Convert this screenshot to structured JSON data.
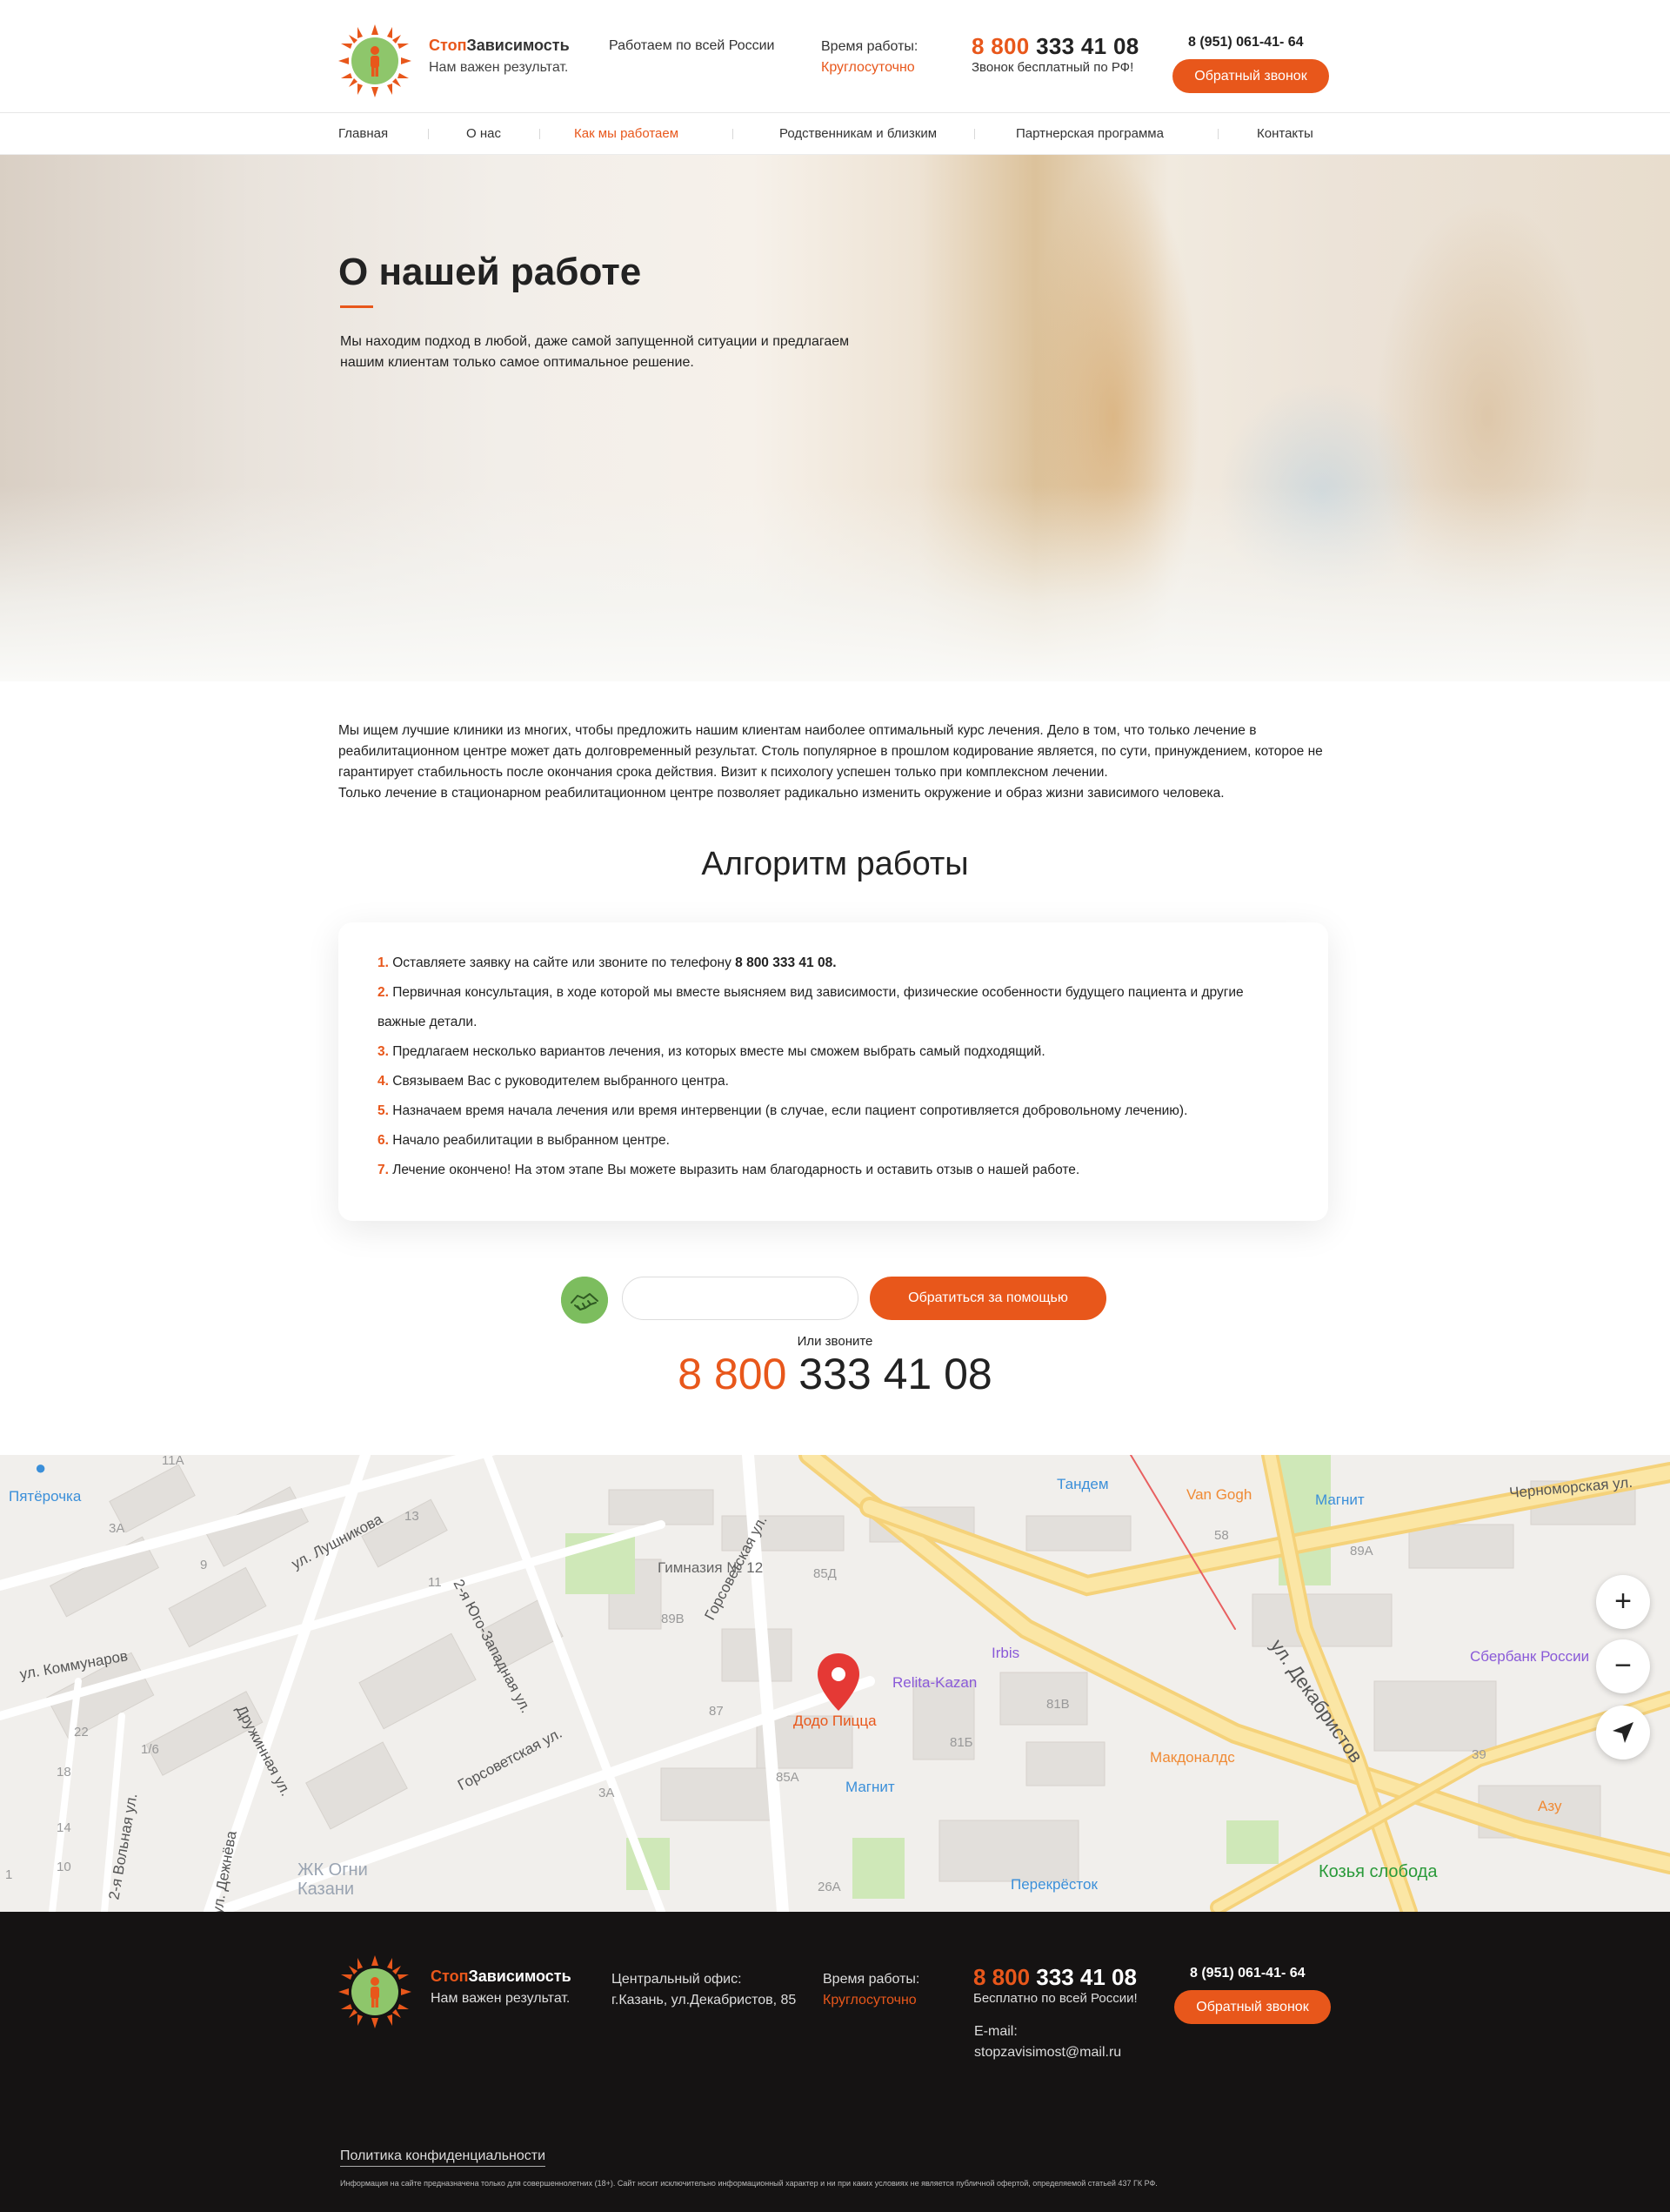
{
  "header": {
    "brand_stop": "Стоп",
    "brand_rest": "Зависимость",
    "slogan": "Нам важен результат.",
    "region": "Работаем по всей России",
    "hours_label": "Время работы:",
    "hours_value": "Круглосуточно",
    "phone_prefix": "8 800",
    "phone_rest": " 333 41 08",
    "phone_note": "Звонок бесплатный по РФ!",
    "phone2": "8 (951) 061-41- 64",
    "callback_button": "Обратный звонок"
  },
  "nav": {
    "items": [
      {
        "label": "Главная"
      },
      {
        "label": "О нас"
      },
      {
        "label": "Как мы работаем"
      },
      {
        "label": "Родственникам и близким"
      },
      {
        "label": "Партнерская программа"
      },
      {
        "label": "Контакты"
      }
    ],
    "active": "Как мы работаем"
  },
  "hero": {
    "title": "О нашей работе",
    "text": "Мы находим подход в любой, даже самой запущенной ситуации и предлагаем нашим клиентам только самое оптимальное решение."
  },
  "intro": {
    "p1": "Мы ищем лучшие клиники из многих, чтобы предложить нашим клиентам наиболее оптимальный курс лечения. Дело в том, что только лечение в реабилитационном центре может дать долговременный результат. Столь популярное в прошлом кодирование является, по сути, принуждением, которое не гарантирует стабильность после окончания срока действия. Визит к психологу успешен только при комплексном лечении.",
    "p2": "Только лечение в стационарном реабилитационном центре позволяет радикально изменить окружение и образ жизни зависимого человека."
  },
  "algorithm": {
    "title": "Алгоритм работы",
    "steps": [
      {
        "num": "1.",
        "text": " Оставляете заявку на сайте или звоните по телефону ",
        "bold": " 8 800 333 41 08."
      },
      {
        "num": "2.",
        "text": " Первичная консультация, в ходе которой мы вместе выясняем вид зависимости, физические особенности будущего пациента и другие важные детали.",
        "bold": ""
      },
      {
        "num": "3.",
        "text": " Предлагаем несколько вариантов лечения, из которых вместе мы сможем выбрать самый подходящий.",
        "bold": ""
      },
      {
        "num": "4.",
        "text": " Связываем Вас с руководителем выбранного центра.",
        "bold": ""
      },
      {
        "num": "5.",
        "text": " Назначаем время начала лечения или время интервенции (в случае, если пациент сопротивляется добровольному лечению).",
        "bold": ""
      },
      {
        "num": "6.",
        "text": " Начало реабилитации в выбранном центре.",
        "bold": ""
      },
      {
        "num": "7.",
        "text": " Лечение окончено! На этом этапе Вы можете выразить нам благодарность и оставить отзыв о нашей работе.",
        "bold": ""
      }
    ]
  },
  "form": {
    "input_value": "",
    "button": "Обратиться за помощью",
    "or_call": "Или звоните",
    "phone_prefix": "8 800",
    "phone_rest": " 333 41 08"
  },
  "map": {
    "streets": [
      "ул. Лушникова",
      "2-я Юго-Западная ул.",
      "ул. Коммунаров",
      "Горсоветская ул.",
      "Дружинная ул.",
      "2-я Вольная ул.",
      "ул. Дежнёва",
      "ул. Декабристов",
      "Черноморская ул.",
      "ул. Лушникова"
    ],
    "places": [
      {
        "name": "Пятёрочка",
        "color": "#3b8fd9"
      },
      {
        "name": "Тандем",
        "color": "#3b8fd9"
      },
      {
        "name": "Van Gogh",
        "color": "#f08a34"
      },
      {
        "name": "Магнит",
        "color": "#3b8fd9"
      },
      {
        "name": "Гимназия № 12",
        "color": "#777777"
      },
      {
        "name": "Irbis",
        "color": "#8a5ad8"
      },
      {
        "name": "Relita-Kazan",
        "color": "#8a5ad8"
      },
      {
        "name": "Сбербанк России",
        "color": "#8a5ad8"
      },
      {
        "name": "Додо Пицца",
        "color": "#e8571b"
      },
      {
        "name": "Магнит",
        "color": "#3b8fd9"
      },
      {
        "name": "Макдоналдс",
        "color": "#f08a34"
      },
      {
        "name": "Азу",
        "color": "#f08a34"
      },
      {
        "name": "Перекрёсток",
        "color": "#3b8fd9"
      },
      {
        "name": "Козья слобода",
        "color": "#2a9a3a"
      },
      {
        "name": "ЖК Огни Казани",
        "color": "#9aa4b2"
      }
    ],
    "house_numbers": [
      "11А",
      "3А",
      "9",
      "13",
      "11",
      "22",
      "1/6",
      "18",
      "14",
      "10",
      "89В",
      "87",
      "85А",
      "85Д",
      "81В",
      "81Б",
      "58",
      "89А",
      "3А",
      "26А",
      "39",
      "1"
    ],
    "zoom_in": "+",
    "zoom_out": "−"
  },
  "footer": {
    "brand_stop": "Стоп",
    "brand_rest": "Зависимость",
    "slogan": "Нам важен результат.",
    "office_label": "Центральный офис:",
    "office_address": "г.Казань, ул.Декабристов, 85",
    "hours_label": "Время работы:",
    "hours_value": "Круглосуточно",
    "phone_prefix": "8 800",
    "phone_rest": " 333 41 08",
    "phone_note": "Бесплатно по всей России!",
    "phone2": "8 (951) 061-41- 64",
    "callback_button": "Обратный звонок",
    "email_label": "E-mail:",
    "email": "stopzavisimost@mail.ru",
    "policy": "Политика конфиденциальности",
    "disclaimer": "Информация на сайте предназначена только для совершеннолетних (18+). Сайт носит исключительно информационный характер и ни при каких условиях не является публичной офертой, определяемой статьей 437 ГК РФ."
  },
  "colors": {
    "accent": "#e8571b",
    "green": "#7cbd5e",
    "footer_bg": "#151313"
  }
}
